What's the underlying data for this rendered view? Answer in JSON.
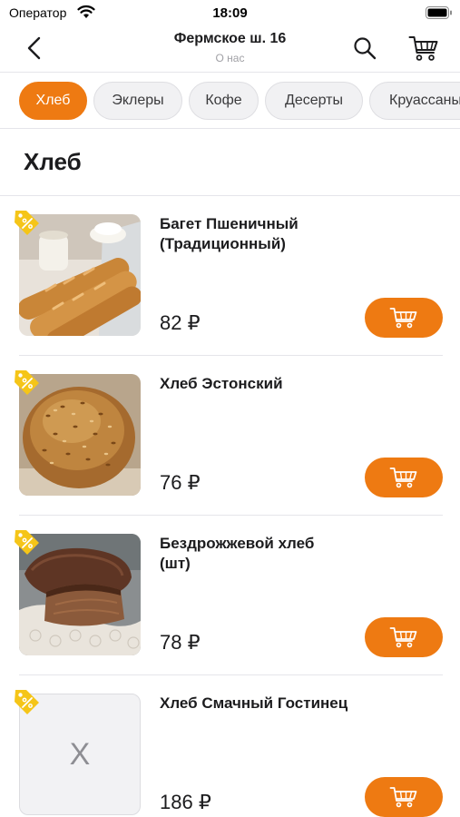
{
  "status_bar": {
    "carrier": "Оператор",
    "time": "18:09"
  },
  "nav": {
    "title": "Фермское ш. 16",
    "subtitle": "О нас"
  },
  "categories": [
    "Хлеб",
    "Эклеры",
    "Кофе",
    "Десерты",
    "Круассаны"
  ],
  "active_category": "Хлеб",
  "section": {
    "title": "Хлеб"
  },
  "products": [
    {
      "name": "Багет Пшеничный (Традиционный)",
      "price": "82 ₽",
      "image": "baguette-photo"
    },
    {
      "name": "Хлеб Эстонский",
      "price": "76 ₽",
      "image": "seeded-bread-photo"
    },
    {
      "name": "Бездрожжевой хлеб (шт)",
      "price": "78 ₽",
      "image": "rye-bread-photo"
    },
    {
      "name": "Хлеб Смачный Гостинец",
      "price": "186 ₽",
      "image": "placeholder",
      "placeholder_text": "X"
    }
  ],
  "colors": {
    "accent": "#ee7a12",
    "tag": "#f5c518",
    "chip_bg": "#f1f1f3"
  }
}
